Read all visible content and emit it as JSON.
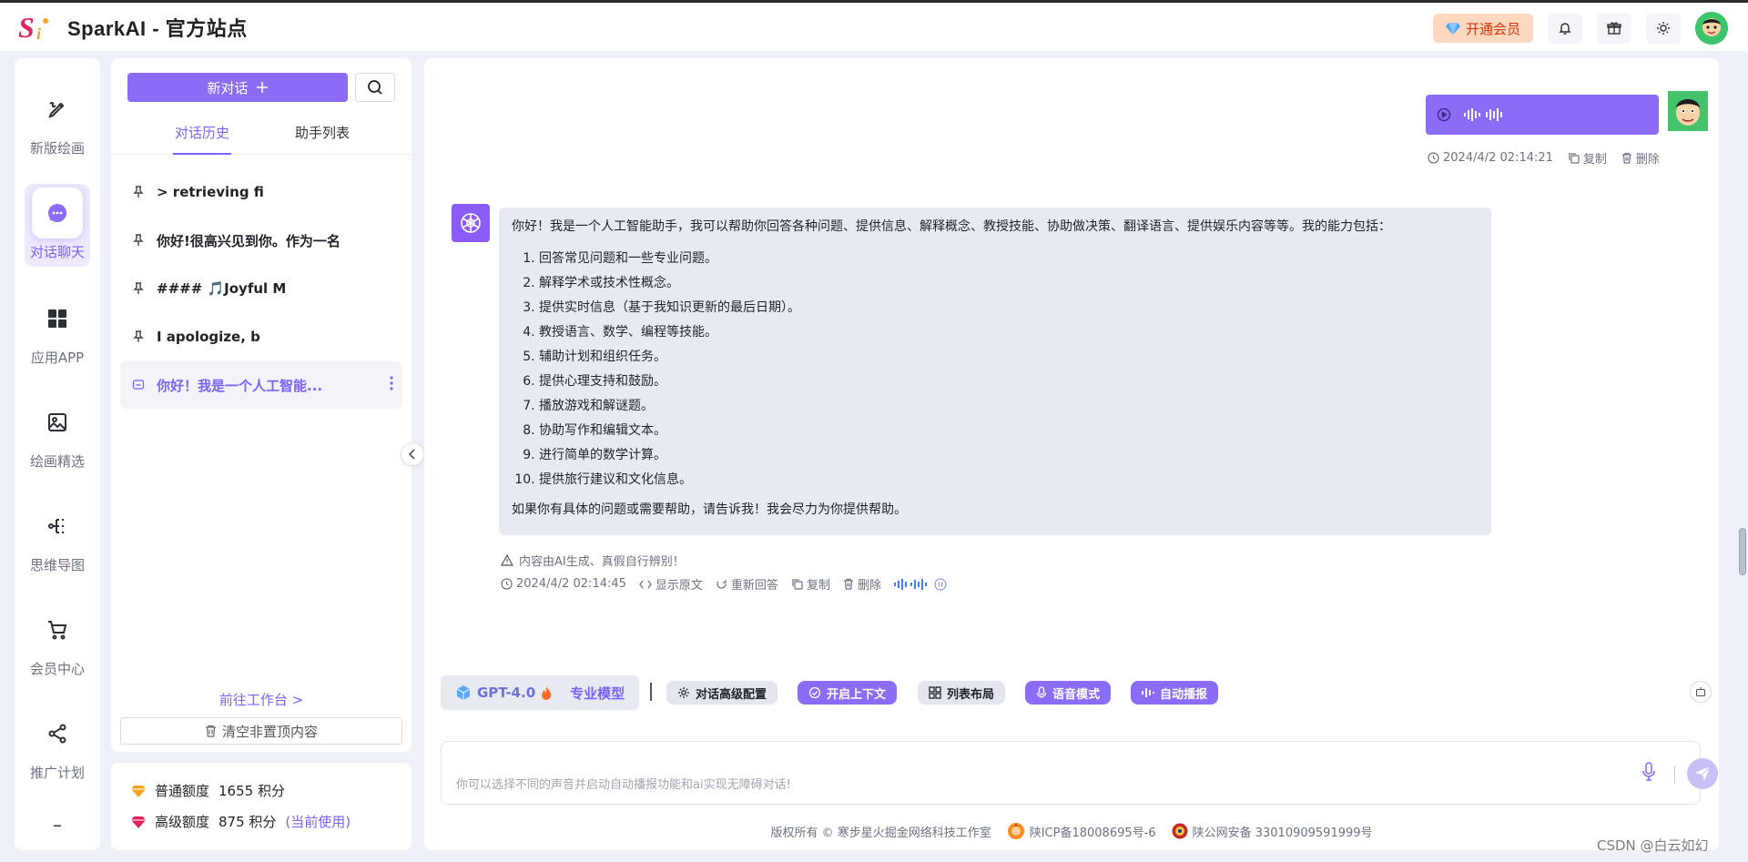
{
  "header": {
    "app_title": "SparkAI - 官方站点",
    "vip_label": "开通会员",
    "colors": {
      "accent": "#7b61ff",
      "vip_bg": "#ffd8bf"
    }
  },
  "nav": {
    "items": [
      {
        "label": "新版绘画",
        "icon": "brush-icon"
      },
      {
        "label": "对话聊天",
        "icon": "chat-bubble-icon",
        "active": true
      },
      {
        "label": "应用APP",
        "icon": "grid-icon"
      },
      {
        "label": "绘画精选",
        "icon": "image-icon"
      },
      {
        "label": "思维导图",
        "icon": "mindmap-icon"
      },
      {
        "label": "会员中心",
        "icon": "cart-icon"
      },
      {
        "label": "推广计划",
        "icon": "share-icon"
      }
    ],
    "more_glyph": "–"
  },
  "sidebar": {
    "new_chat_label": "新对话",
    "tabs": [
      {
        "label": "对话历史",
        "active": true
      },
      {
        "label": "助手列表"
      }
    ],
    "conversations": [
      {
        "title": "> retrieving fi",
        "pinned": true
      },
      {
        "title": "你好!很高兴见到你。作为一名",
        "pinned": true
      },
      {
        "title": "#### 🎵Joyful M",
        "pinned": true
      },
      {
        "title": "I apologize, b",
        "pinned": true
      },
      {
        "title": "你好！我是一个人工智能...",
        "active": true
      }
    ],
    "goto_workspace": "前往工作台 >",
    "clear_label": "清空非置顶内容"
  },
  "quota": {
    "normal_label": "普通额度",
    "normal_value": "1655 积分",
    "advanced_label": "高级额度",
    "advanced_value": "875 积分",
    "current_tag": "(当前使用)"
  },
  "chat": {
    "user_message": {
      "timestamp": "2024/4/2 02:14:21",
      "copy_label": "复制",
      "delete_label": "删除"
    },
    "bot_message": {
      "intro": "你好！我是一个人工智能助手，我可以帮助你回答各种问题、提供信息、解释概念、教授技能、协助做决策、翻译语言、提供娱乐内容等等。我的能力包括：",
      "items": [
        "回答常见问题和一些专业问题。",
        "解释学术或技术性概念。",
        "提供实时信息（基于我知识更新的最后日期）。",
        "教授语言、数学、编程等技能。",
        "辅助计划和组织任务。",
        "提供心理支持和鼓励。",
        "播放游戏和解谜题。",
        "协助写作和编辑文本。",
        "进行简单的数学计算。",
        "提供旅行建议和文化信息。"
      ],
      "outro": "如果你有具体的问题或需要帮助，请告诉我！我会尽力为你提供帮助。",
      "ai_note": "内容由AI生成、真假自行辨别！",
      "timestamp": "2024/4/2 02:14:45",
      "show_raw_label": "显示原文",
      "regenerate_label": "重新回答",
      "copy_label": "复制",
      "delete_label": "删除"
    }
  },
  "toolbar": {
    "model_name": "GPT-4.0",
    "model_tag": "专业模型",
    "separator": "|",
    "buttons": [
      {
        "label": "对话高级配置",
        "style": "grey"
      },
      {
        "label": "开启上下文",
        "style": "purple"
      },
      {
        "label": "列表布局",
        "style": "grey"
      },
      {
        "label": "语音模式",
        "style": "purple"
      },
      {
        "label": "自动播报",
        "style": "purple"
      }
    ]
  },
  "input": {
    "placeholder": "你可以选择不同的声音并启动自动播报功能和ai实现无障碍对话!"
  },
  "footer": {
    "copyright": "版权所有 © 寒步星火掘金网络科技工作室",
    "icp": "陕ICP备18008695号-6",
    "police": "陕公网安备 33010909591999号"
  },
  "watermark": "CSDN @白云如幻"
}
